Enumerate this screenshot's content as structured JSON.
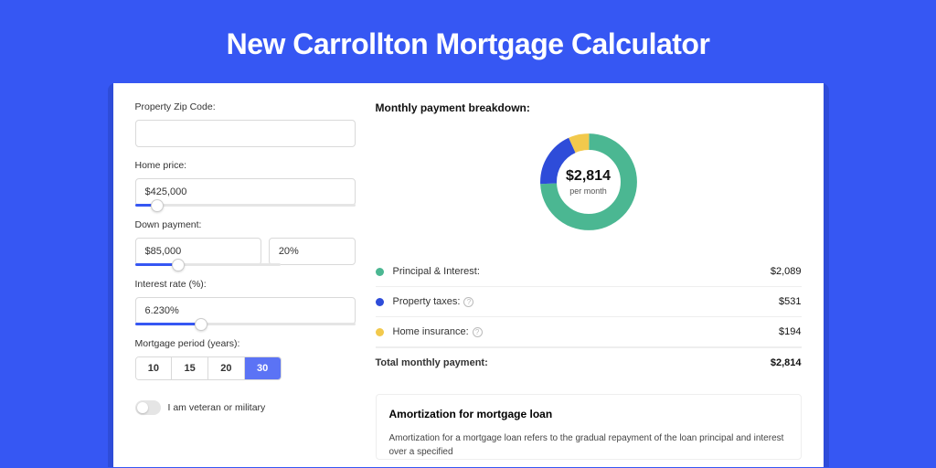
{
  "page": {
    "title": "New Carrollton Mortgage Calculator"
  },
  "form": {
    "zip": {
      "label": "Property Zip Code:",
      "value": ""
    },
    "home_price": {
      "label": "Home price:",
      "value": "$425,000",
      "slider_pct": 10
    },
    "down_payment": {
      "label": "Down payment:",
      "amount": "$85,000",
      "percent": "20%",
      "slider_pct": 20
    },
    "interest_rate": {
      "label": "Interest rate (%):",
      "value": "6.230%",
      "slider_pct": 30
    },
    "mortgage_period": {
      "label": "Mortgage period (years):",
      "options": [
        "10",
        "15",
        "20",
        "30"
      ],
      "selected": 3
    },
    "veteran": {
      "label": "I am veteran or military"
    }
  },
  "breakdown": {
    "title": "Monthly payment breakdown:",
    "center_value": "$2,814",
    "center_sub": "per month",
    "items": [
      {
        "label": "Principal & Interest:",
        "value": "$2,089",
        "color": "#4bb792",
        "show_info": false
      },
      {
        "label": "Property taxes:",
        "value": "$531",
        "color": "#2e4cd9",
        "show_info": true
      },
      {
        "label": "Home insurance:",
        "value": "$194",
        "color": "#f2c94c",
        "show_info": true
      }
    ],
    "total": {
      "label": "Total monthly payment:",
      "value": "$2,814"
    }
  },
  "amortization": {
    "title": "Amortization for mortgage loan",
    "text": "Amortization for a mortgage loan refers to the gradual repayment of the loan principal and interest over a specified"
  },
  "colors": {
    "accent": "#3657f3"
  },
  "chart_data": {
    "type": "pie",
    "title": "Monthly payment breakdown",
    "series": [
      {
        "name": "Principal & Interest",
        "value": 2089,
        "color": "#4bb792"
      },
      {
        "name": "Property taxes",
        "value": 531,
        "color": "#2e4cd9"
      },
      {
        "name": "Home insurance",
        "value": 194,
        "color": "#f2c94c"
      }
    ],
    "total": 2814
  }
}
